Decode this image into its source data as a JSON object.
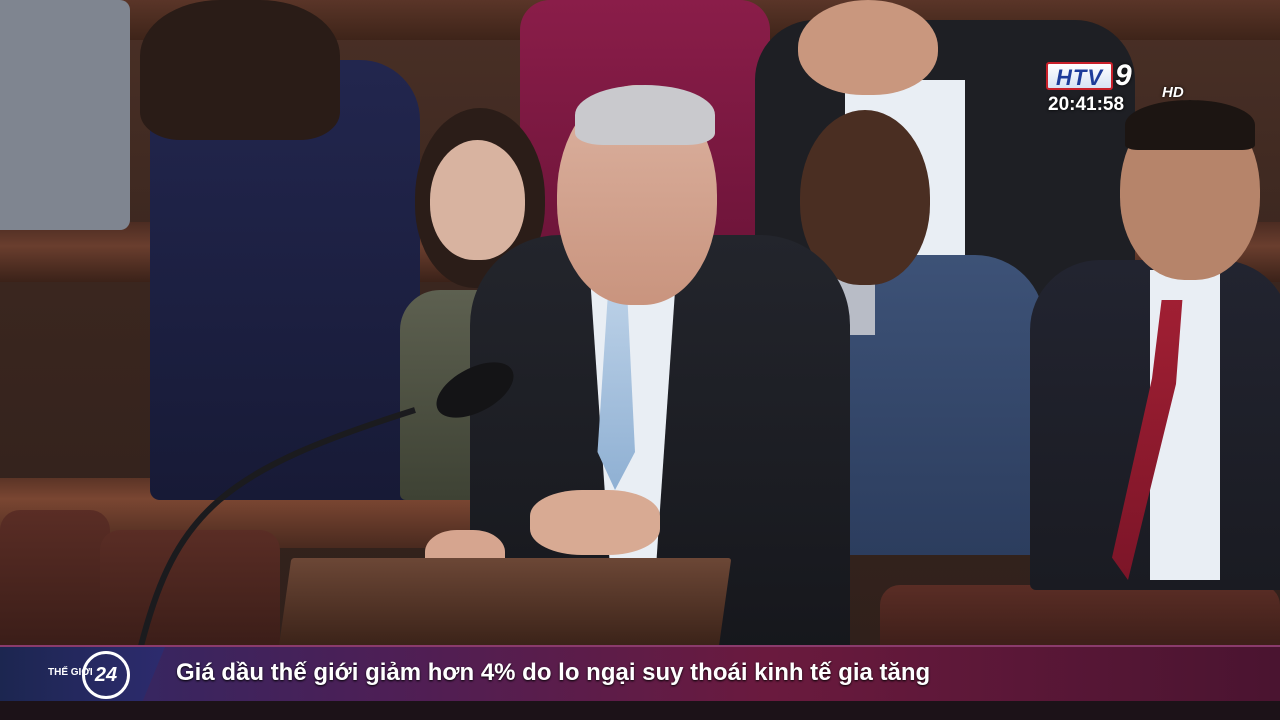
{
  "broadcaster": {
    "logo_text": "HTV",
    "logo_number": "9",
    "logo_suffix": "HD",
    "clock": "20:41:58"
  },
  "lower_third": {
    "segment_small": "THẾ GIỚI",
    "segment_number": "24",
    "headline": "Giá dầu thế giới giảm hơn 4% do lo ngại suy thoái kinh tế gia tăng"
  },
  "colors": {
    "ticker_start": "#2a2a66",
    "ticker_end": "#6a1a3e",
    "logo_red": "#c8202a",
    "logo_blue": "#1d3c9a"
  }
}
